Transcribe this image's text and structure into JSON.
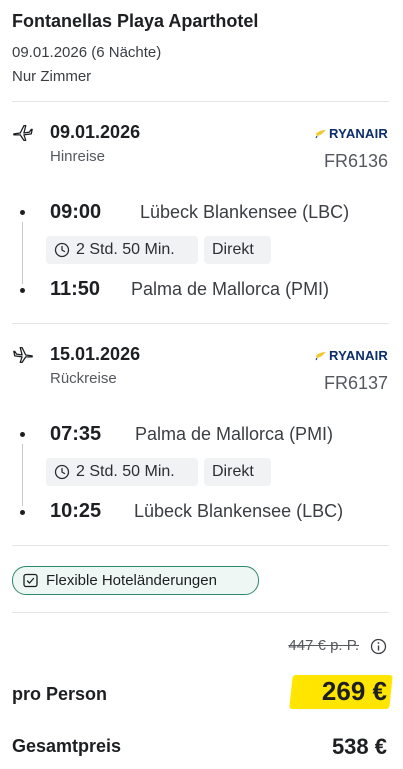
{
  "hotel": {
    "title": "Fontanellas Playa Aparthotel",
    "dates": "09.01.2026 (6 Nächte)",
    "board": "Nur Zimmer"
  },
  "outbound": {
    "date": "09.01.2026",
    "direction": "Hinreise",
    "airline": "RYANAIR",
    "flight_no": "FR6136",
    "departure_time": "09:00",
    "departure_airport": "Lübeck Blankensee (LBC)",
    "duration": "2 Std. 50 Min.",
    "stops": "Direkt",
    "arrival_time": "11:50",
    "arrival_airport": "Palma de Mallorca (PMI)"
  },
  "return": {
    "date": "15.01.2026",
    "direction": "Rückreise",
    "airline": "RYANAIR",
    "flight_no": "FR6137",
    "departure_time": "07:35",
    "departure_airport": "Palma de Mallorca (PMI)",
    "duration": "2 Std. 50 Min.",
    "stops": "Direkt",
    "arrival_time": "10:25",
    "arrival_airport": "Lübeck Blankensee (LBC)"
  },
  "badge": {
    "label": "Flexible Hoteländerungen"
  },
  "pricing": {
    "old_price": "447 € p. P.",
    "per_person_label": "pro Person",
    "per_person_price": "269 €",
    "total_label": "Gesamtpreis",
    "total_price": "538 €"
  },
  "colors": {
    "highlight": "#ffe500",
    "airline_blue": "#0b2d6b",
    "badge_green": "#2f8a6a"
  },
  "icons": [
    "plane-departure-icon",
    "plane-arrival-icon",
    "ryanair-harp-icon",
    "clock-icon",
    "checklist-icon",
    "info-icon"
  ]
}
